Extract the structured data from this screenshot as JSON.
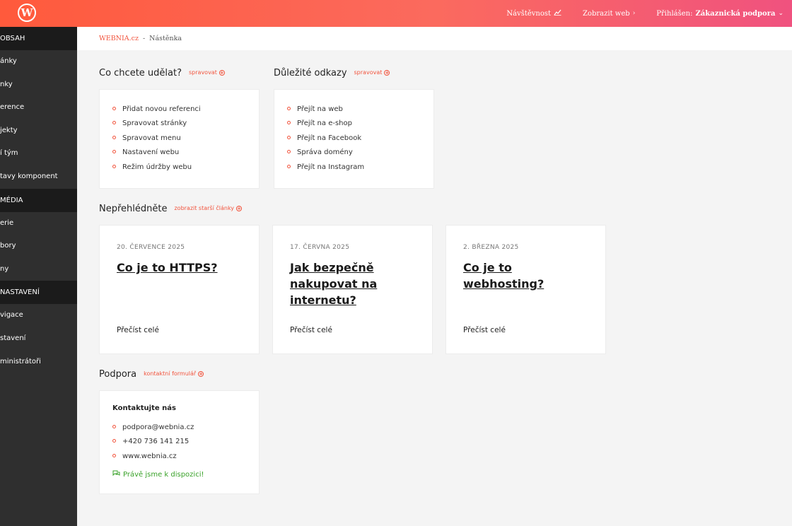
{
  "topbar": {
    "logo_letter": "W",
    "nav": {
      "visits_label": "Návštěvnost",
      "visits_icon": "trend-chart-icon",
      "view_web_label": "Zobrazit web",
      "view_web_icon": "chevron-right-icon",
      "logged_in_label": "Přihlášen:",
      "user_name": "Zákaznická podpora",
      "user_menu_icon": "chevron-down-icon"
    }
  },
  "sidebar": {
    "items": [
      {
        "label": "OBSAH",
        "type": "head"
      },
      {
        "label": "ánky",
        "type": "item"
      },
      {
        "label": "nky",
        "type": "item"
      },
      {
        "label": "erence",
        "type": "item"
      },
      {
        "label": "jekty",
        "type": "item"
      },
      {
        "label": "í tým",
        "type": "item"
      },
      {
        "label": "tavy komponent",
        "type": "item"
      },
      {
        "label": "MÉDIA",
        "type": "head"
      },
      {
        "label": "erie",
        "type": "item"
      },
      {
        "label": "bory",
        "type": "item"
      },
      {
        "label": "ny",
        "type": "item"
      },
      {
        "label": "NASTAVENÍ",
        "type": "head"
      },
      {
        "label": "vigace",
        "type": "item"
      },
      {
        "label": "stavení",
        "type": "item"
      },
      {
        "label": "ministrátoři",
        "type": "item"
      }
    ]
  },
  "breadcrumb": {
    "site": "WEBNIA.cz",
    "separator": "-",
    "current": "Nástěnka"
  },
  "actions": {
    "title": "Co chcete udělat?",
    "manage_label": "spravovat",
    "items": [
      "Přidat novou referenci",
      "Spravovat stránky",
      "Spravovat menu",
      "Nastavení webu",
      "Režim údržby webu"
    ]
  },
  "links": {
    "title": "Důležité odkazy",
    "manage_label": "spravovat",
    "items": [
      "Přejít na web",
      "Přejít na e-shop",
      "Přejít na Facebook",
      "Správa domény",
      "Přejít na Instagram"
    ]
  },
  "news": {
    "title": "Nepřehlédněte",
    "older_label": "zobrazit starší články",
    "articles": [
      {
        "date": "20. ČERVENCE 2025",
        "title": "Co je to HTTPS?",
        "more": "Přečíst celé"
      },
      {
        "date": "17. ČERVNA 2025",
        "title": "Jak bezpečně nakupovat na internetu?",
        "more": "Přečíst celé"
      },
      {
        "date": "2. BŘEZNA 2025",
        "title": "Co je to webhosting?",
        "more": "Přečíst celé"
      }
    ]
  },
  "support": {
    "title": "Podpora",
    "form_label": "kontaktní formulář",
    "contact_heading": "Kontaktujte nás",
    "contacts": [
      "podpora@webnia.cz",
      "+420 736 141 215",
      "www.webnia.cz"
    ],
    "status": "Právě jsme k dispozici!",
    "status_icon": "chat-bubbles-icon"
  },
  "colors": {
    "accent": "#f2543d",
    "topbar_start": "#ff5a3c",
    "topbar_end": "#f0527f",
    "sidebar_bg": "#2f2f2f",
    "sidebar_head_bg": "#1b1b1b",
    "status_green": "#3aa22a"
  }
}
